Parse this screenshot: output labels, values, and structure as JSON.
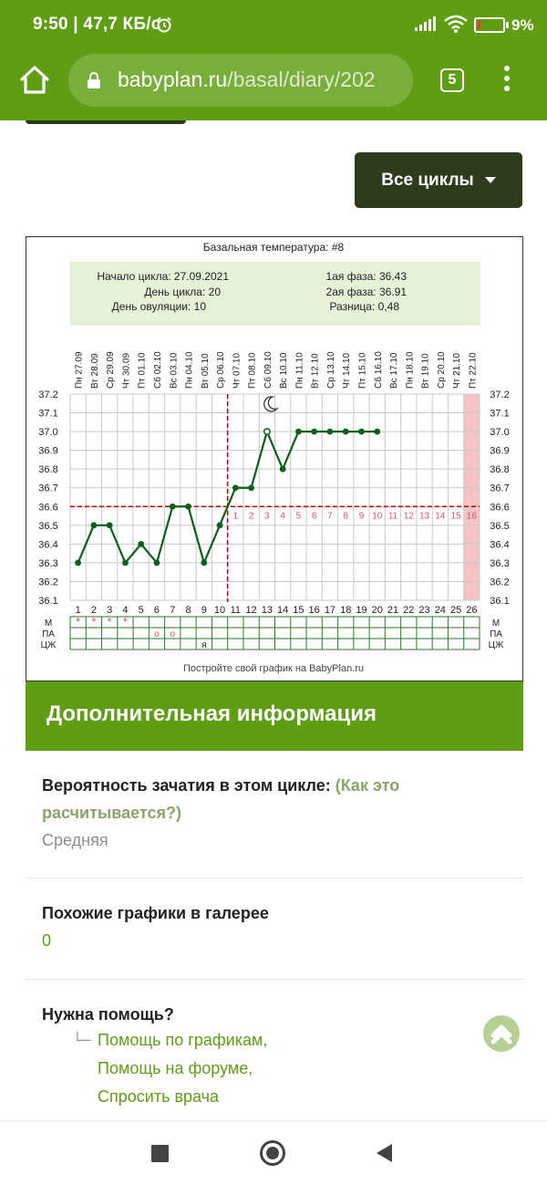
{
  "status_bar": {
    "time": "9:50 | 47,7 КБ/с",
    "battery": "9%"
  },
  "browser": {
    "url_host": "babyplan.ru",
    "url_path": "/basal/diary/202",
    "tab_count": "5"
  },
  "cycles_button": {
    "label": "Все циклы"
  },
  "chart_data": {
    "type": "line",
    "title": "Базальная температура: #8",
    "info": {
      "cycle_start": "Начало цикла: 27.09.2021",
      "cycle_day": "День цикла: 20",
      "ovulation_day": "День овуляции: 10",
      "phase1": "1ая фаза: 36.43",
      "phase2": "2ая фаза: 36.91",
      "difference": "Разница: 0,48"
    },
    "dates": [
      "Пн 27.09",
      "Вт 28.09",
      "Ср 29.09",
      "Чт 30.09",
      "Пт 01.10",
      "Сб 02.10",
      "Вс 03.10",
      "Пн 04.10",
      "Вт 05.10",
      "Ср 06.10",
      "Чт 07.10",
      "Пт 08.10",
      "Сб 09.10",
      "Вс 10.10",
      "Пн 11.10",
      "Вт 12.10",
      "Ср 13.10",
      "Чт 14.10",
      "Пт 15.10",
      "Сб 16.10",
      "Вс 17.10",
      "Пн 18.10",
      "Вт 19.10",
      "Ср 20.10",
      "Чт 21.10",
      "Пт 22.10"
    ],
    "x": [
      1,
      2,
      3,
      4,
      5,
      6,
      7,
      8,
      9,
      10,
      11,
      12,
      13,
      14,
      15,
      16,
      17,
      18,
      19,
      20,
      21,
      22,
      23,
      24,
      25,
      26
    ],
    "ylim": [
      36.1,
      37.2
    ],
    "yticks": [
      "37.2",
      "37.1",
      "37.0",
      "36.9",
      "36.8",
      "36.7",
      "36.6",
      "36.5",
      "36.4",
      "36.3",
      "36.2",
      "36.1"
    ],
    "series": [
      {
        "values": [
          36.3,
          36.5,
          36.5,
          36.3,
          36.4,
          36.3,
          36.6,
          36.6,
          36.3,
          36.5,
          36.7,
          36.7,
          37.0,
          36.8,
          37.0,
          37.0,
          37.0,
          37.0,
          37.0,
          37.0
        ],
        "color": "#0f5f1c"
      }
    ],
    "cover_line": 36.6,
    "ovulation_day_x": 10,
    "luteal_labels": [
      "1",
      "2",
      "3",
      "4",
      "5",
      "6",
      "7",
      "8",
      "9",
      "10",
      "11",
      "12",
      "13",
      "14",
      "15",
      "16"
    ],
    "highlight_day": 26,
    "moon_day": 13,
    "rows": [
      {
        "label": "М",
        "marks": [
          {
            "day": 1,
            "text": "*"
          },
          {
            "day": 2,
            "text": "*"
          },
          {
            "day": 3,
            "text": "*"
          },
          {
            "day": 4,
            "text": "*"
          }
        ]
      },
      {
        "label": "ПА",
        "marks": [
          {
            "day": 6,
            "text": "o"
          },
          {
            "day": 7,
            "text": "o"
          }
        ]
      },
      {
        "label": "ЦЖ",
        "marks": [
          {
            "day": 9,
            "text": "я"
          }
        ]
      }
    ],
    "footer": "Постройте свой график на BabyPlan.ru",
    "colors": {
      "line": "#0f5f1c",
      "grid": "#c8c8c8",
      "cover": "#cc0000",
      "highlight": "#f6c3c3",
      "info_bg": "#e6f2d7",
      "luteal_label": "#d6556a"
    }
  },
  "additional_info": {
    "heading": "Дополнительная информация",
    "probability_title": "Вероятность зачатия в этом цикле:",
    "probability_hint": "(Как это расчитывается?)",
    "probability_value": "Средняя",
    "similar_title": "Похожие графики в галерее",
    "similar_value": "0",
    "help_title": "Нужна помощь?",
    "help_links": [
      "Помощь по графикам,",
      "Помощь на форуме,",
      "Спросить врача"
    ]
  }
}
